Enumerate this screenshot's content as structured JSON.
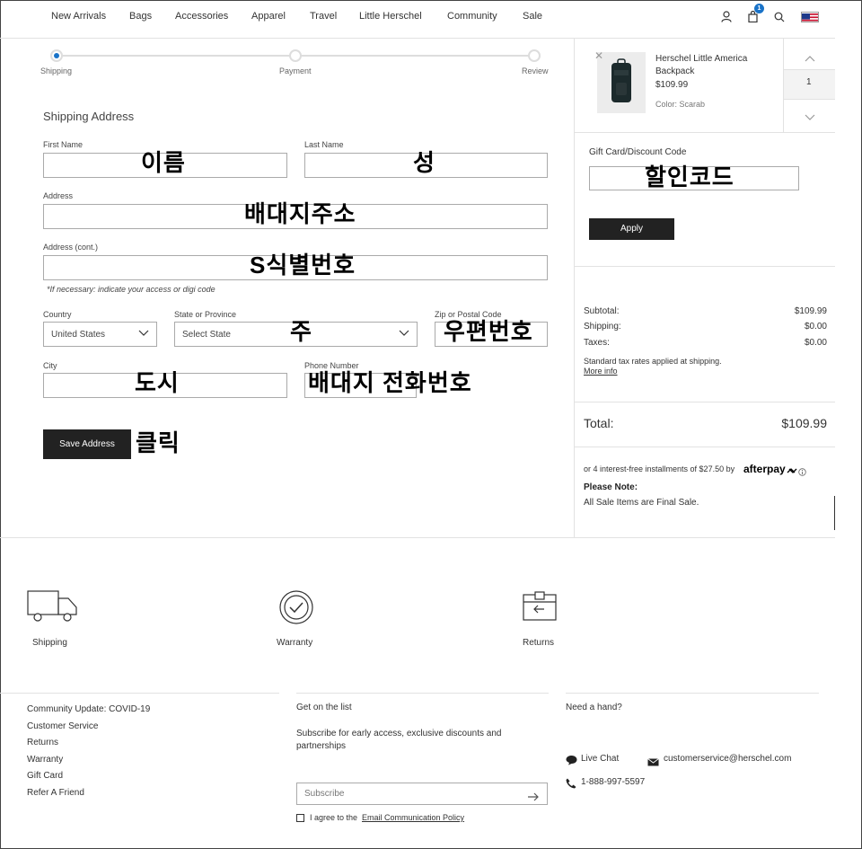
{
  "nav": {
    "items": [
      "New Arrivals",
      "Bags",
      "Accessories",
      "Apparel",
      "Travel",
      "Little Herschel",
      "Community",
      "Sale"
    ],
    "cart_count": "1"
  },
  "steps": [
    "Shipping",
    "Payment",
    "Review"
  ],
  "form": {
    "title": "Shipping Address",
    "first_name_label": "First Name",
    "last_name_label": "Last Name",
    "address_label": "Address",
    "address2_label": "Address (cont.)",
    "address2_note": "*If necessary: indicate your access or digi code",
    "country_label": "Country",
    "country_value": "United States",
    "state_label": "State or Province",
    "state_value": "Select State",
    "zip_label": "Zip or Postal Code",
    "city_label": "City",
    "phone_label": "Phone Number",
    "save_button": "Save Address"
  },
  "annotations": {
    "first_name": "이름",
    "last_name": "성",
    "address": "배대지주소",
    "address2": "S식별번호",
    "state": "주",
    "zip": "우편번호",
    "city": "도시",
    "phone": "배대지 전화번호",
    "save": "클릭",
    "discount": "할인코드"
  },
  "cart": {
    "product_name_line1": "Herschel Little America",
    "product_name_line2": "Backpack",
    "price": "$109.99",
    "color": "Color: Scarab",
    "quantity": "1",
    "discount_label": "Gift Card/Discount Code",
    "apply_button": "Apply",
    "subtotal_label": "Subtotal:",
    "subtotal_value": "$109.99",
    "shipping_label": "Shipping:",
    "shipping_value": "$0.00",
    "taxes_label": "Taxes:",
    "taxes_value": "$0.00",
    "tax_note": "Standard tax rates applied at shipping.",
    "more_info": "More info",
    "total_label": "Total:",
    "total_value": "$109.99",
    "afterpay_text": "or 4 interest-free installments of $27.50 by",
    "afterpay_brand": "afterpay",
    "please_note_title": "Please Note:",
    "please_note_text": "All Sale Items are Final Sale."
  },
  "footer": {
    "features": [
      "Shipping",
      "Warranty",
      "Returns"
    ],
    "links": [
      "Community Update: COVID-19",
      "Customer Service",
      "Returns",
      "Warranty",
      "Gift Card",
      "Refer A Friend"
    ],
    "list_title": "Get on the list",
    "list_text_line1": "Subscribe for early access, exclusive discounts and",
    "list_text_line2": "partnerships",
    "subscribe_placeholder": "Subscribe",
    "agree_prefix": "I agree to the",
    "agree_link": "Email Communication Policy",
    "help_title": "Need a hand?",
    "live_chat": "Live Chat",
    "email": "customerservice@herschel.com",
    "phone": "1-888-997-5597"
  }
}
